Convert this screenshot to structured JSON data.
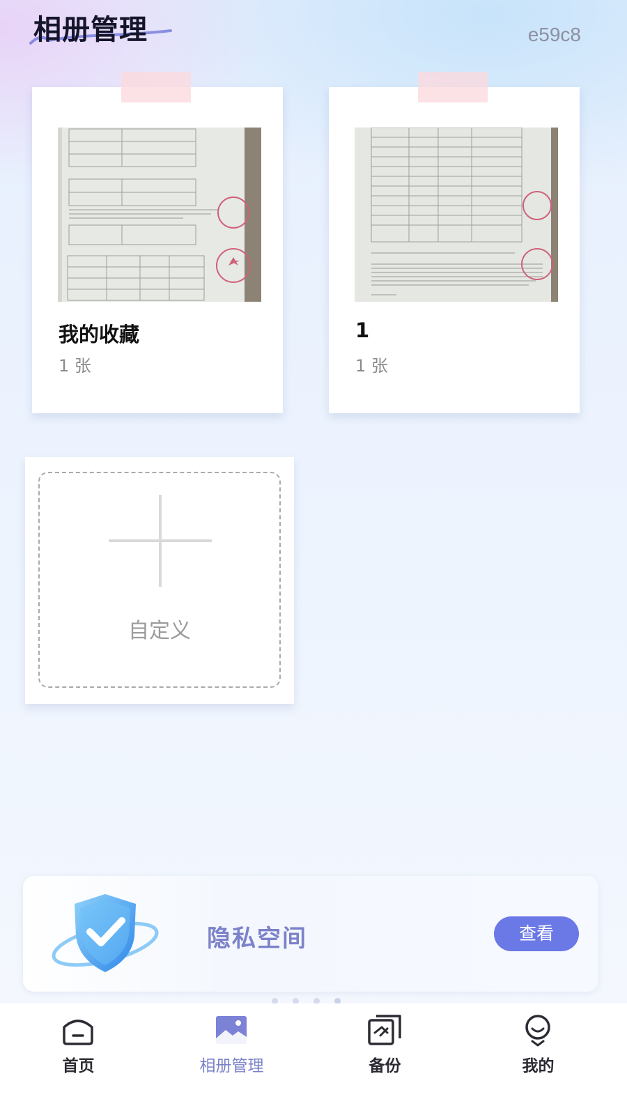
{
  "header": {
    "title": "相册管理",
    "device_id": "e59c8"
  },
  "albums": [
    {
      "name": "我的收藏",
      "count": "1 张"
    },
    {
      "name": "1",
      "count": "1 张"
    }
  ],
  "custom_album": {
    "label": "自定义",
    "icon": "plus-icon"
  },
  "privacy": {
    "title": "隐私空间",
    "button": "查看",
    "icon": "shield-check-icon"
  },
  "tabs": [
    {
      "label": "首页",
      "icon": "home-icon",
      "active": false
    },
    {
      "label": "相册管理",
      "icon": "album-icon",
      "active": true
    },
    {
      "label": "备份",
      "icon": "backup-icon",
      "active": false
    },
    {
      "label": "我的",
      "icon": "profile-icon",
      "active": false
    }
  ],
  "colors": {
    "accent": "#6b79e6",
    "accent_text": "#7c82c9",
    "title": "#14142a",
    "muted": "#8b8b8b"
  }
}
